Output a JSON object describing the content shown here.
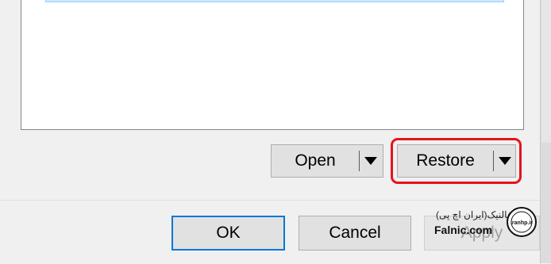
{
  "buttons": {
    "open_label": "Open",
    "restore_label": "Restore",
    "ok_label": "OK",
    "cancel_label": "Cancel",
    "apply_label": "Apply"
  },
  "watermark": {
    "persian_text": "فالنیک(ایران اچ پی)",
    "site_text": "Falnic.com",
    "seal_text": "iranhp.ir"
  },
  "colors": {
    "highlight_ring": "#e4141b",
    "default_button_border": "#0078d7",
    "selection_fill": "#cce8ff"
  }
}
